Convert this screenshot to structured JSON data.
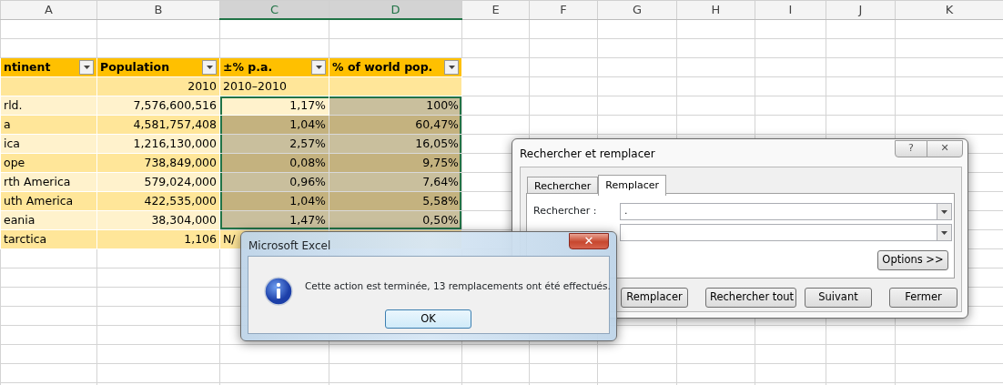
{
  "columns": [
    {
      "label": "A",
      "selected": false
    },
    {
      "label": "B",
      "selected": false
    },
    {
      "label": "C",
      "selected": true
    },
    {
      "label": "D",
      "selected": true
    },
    {
      "label": "E",
      "selected": false
    },
    {
      "label": "F",
      "selected": false
    },
    {
      "label": "G",
      "selected": false
    },
    {
      "label": "H",
      "selected": false
    },
    {
      "label": "I",
      "selected": false
    },
    {
      "label": "J",
      "selected": false
    },
    {
      "label": "K",
      "selected": false
    }
  ],
  "table": {
    "headers": [
      "ntinent",
      "Population",
      "±% p.a.",
      "% of world pop."
    ],
    "subheader": {
      "population": "2010",
      "growth": "2010–2010"
    },
    "rows": [
      {
        "continent": "rld.",
        "population": "7,576,600,516",
        "growth": "1,17%",
        "share": "100%",
        "selected": true,
        "active": true
      },
      {
        "continent": "a",
        "population": "4,581,757,408",
        "growth": "1,04%",
        "share": "60,47%",
        "selected": true,
        "active": false
      },
      {
        "continent": "ica",
        "population": "1,216,130,000",
        "growth": "2,57%",
        "share": "16,05%",
        "selected": true,
        "active": false
      },
      {
        "continent": "ope",
        "population": "738,849,000",
        "growth": "0,08%",
        "share": "9,75%",
        "selected": true,
        "active": false
      },
      {
        "continent": "rth America",
        "population": "579,024,000",
        "growth": "0,96%",
        "share": "7,64%",
        "selected": true,
        "active": false
      },
      {
        "continent": "uth America",
        "population": "422,535,000",
        "growth": "1,04%",
        "share": "5,58%",
        "selected": true,
        "active": false
      },
      {
        "continent": "eania",
        "population": "38,304,000",
        "growth": "1,47%",
        "share": "0,50%",
        "selected": true,
        "active": false
      },
      {
        "continent": "tarctica",
        "population": "1,106",
        "growth": "N/",
        "selected": false,
        "active": false
      }
    ]
  },
  "find_dialog": {
    "title": "Rechercher et remplacer",
    "help": "?",
    "close": "✕",
    "tabs": [
      {
        "label": "Rechercher",
        "selected": false
      },
      {
        "label": "Remplacer",
        "selected": true
      }
    ],
    "fields": [
      {
        "kind": "combo",
        "label": "Rechercher :",
        "value": "."
      },
      {
        "kind": "combo"
      }
    ],
    "options_button": "Options >>",
    "buttons": [
      "Remplacer",
      "Rechercher tout",
      "Suivant",
      "Fermer"
    ]
  },
  "message_box": {
    "title": "Microsoft Excel",
    "close": "✕",
    "message": "Cette action est terminée, 13 remplacements ont été effectués.",
    "button": "OK"
  }
}
